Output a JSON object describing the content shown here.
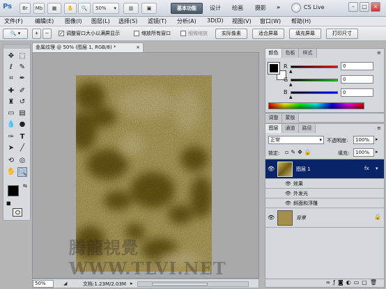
{
  "app": {
    "logo": "Ps",
    "titlebar_buttons": [
      "Br",
      "Mb"
    ],
    "zoom_select": "50%",
    "workspaces": [
      "基本功能",
      "设计",
      "绘画",
      "摄影"
    ],
    "more": "»",
    "cs_live": "CS Live",
    "window_controls": [
      "–",
      "□",
      "×"
    ]
  },
  "menubar": {
    "items": [
      "文件(F)",
      "编辑(E)",
      "图像(I)",
      "图层(L)",
      "选择(S)",
      "滤镜(T)",
      "分析(A)",
      "3D(D)",
      "视图(V)",
      "窗口(W)",
      "帮助(H)"
    ]
  },
  "options": {
    "check1_label": "调整窗口大小以满屏显示",
    "check2_label": "缩放所有窗口",
    "check3_label": "细微缩放",
    "btn_actual": "实际像素",
    "btn_fit": "适合屏幕",
    "btn_fill": "填充屏幕",
    "btn_print": "打印尺寸"
  },
  "document": {
    "tab_title": "金属纹理 @ 50% (图层 1, RGB/8) *",
    "tab_close": "×",
    "watermark": "腾龍視覺 WWW.TLVI.NET",
    "zoom": "50%",
    "doc_info": "文档:1.23M/2.03M"
  },
  "color_panel": {
    "tabs": [
      "颜色",
      "色板",
      "样式"
    ],
    "channels": [
      {
        "label": "R",
        "value": "0"
      },
      {
        "label": "G",
        "value": "0"
      },
      {
        "label": "B",
        "value": "0"
      }
    ]
  },
  "adjust_panel": {
    "tabs": [
      "调整",
      "蒙版"
    ]
  },
  "layers_panel": {
    "tabs": [
      "图层",
      "通道",
      "路径"
    ],
    "blend_mode": "正常",
    "opacity_label": "不透明度:",
    "opacity": "100%",
    "lock_label": "锁定:",
    "fill_label": "填充:",
    "fill": "100%",
    "layers": [
      {
        "name": "图层 1",
        "effects_label": "效果",
        "effects": [
          "外发光",
          "斜面和浮雕"
        ]
      },
      {
        "name": "背景"
      }
    ]
  },
  "colors": {
    "foreground": "#000000",
    "background": "#ffffff",
    "selected_layer": "#0a246a"
  }
}
